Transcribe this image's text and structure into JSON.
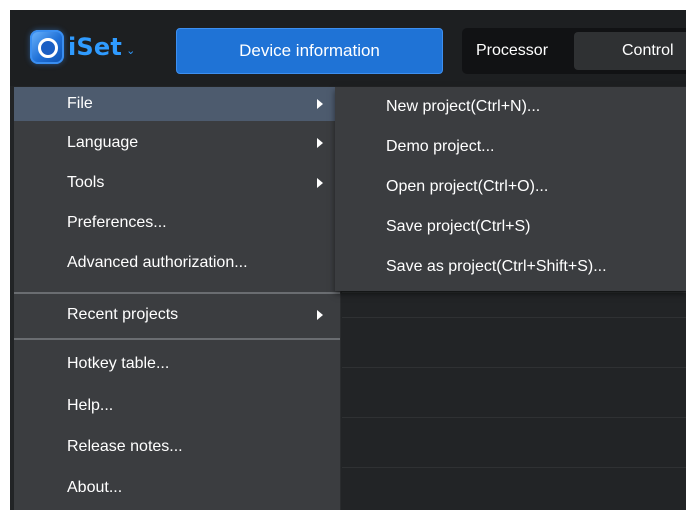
{
  "app": {
    "logo_text": "iSet",
    "logo_icon": "iset-logo-icon",
    "logo_caret": "chevron-down-icon"
  },
  "header": {
    "active_button_label": "Device information",
    "tabs": [
      {
        "label": "Processor"
      },
      {
        "label": "Control"
      }
    ]
  },
  "menu": {
    "items": [
      {
        "label": "File",
        "has_submenu": true,
        "selected": true
      },
      {
        "label": "Language",
        "has_submenu": true
      },
      {
        "label": "Tools",
        "has_submenu": true
      },
      {
        "label": "Preferences...",
        "has_submenu": false
      },
      {
        "label": "Advanced authorization...",
        "has_submenu": false
      },
      {
        "label": "Recent projects",
        "has_submenu": true
      },
      {
        "label": "Hotkey table...",
        "has_submenu": false
      },
      {
        "label": "Help...",
        "has_submenu": false
      },
      {
        "label": "Release notes...",
        "has_submenu": false
      },
      {
        "label": "About...",
        "has_submenu": false
      }
    ]
  },
  "submenu": {
    "items": [
      {
        "label": "New project(Ctrl+N)..."
      },
      {
        "label": "Demo project..."
      },
      {
        "label": "Open project(Ctrl+O)..."
      },
      {
        "label": "Save project(Ctrl+S)"
      },
      {
        "label": "Save as project(Ctrl+Shift+S)..."
      }
    ]
  },
  "colors": {
    "accent": "#1f73d6",
    "logo_blue": "#2f9bff",
    "menu_bg": "#3b3d40",
    "menu_selected": "#4d5b6e",
    "header_bg": "#1d1f21"
  }
}
